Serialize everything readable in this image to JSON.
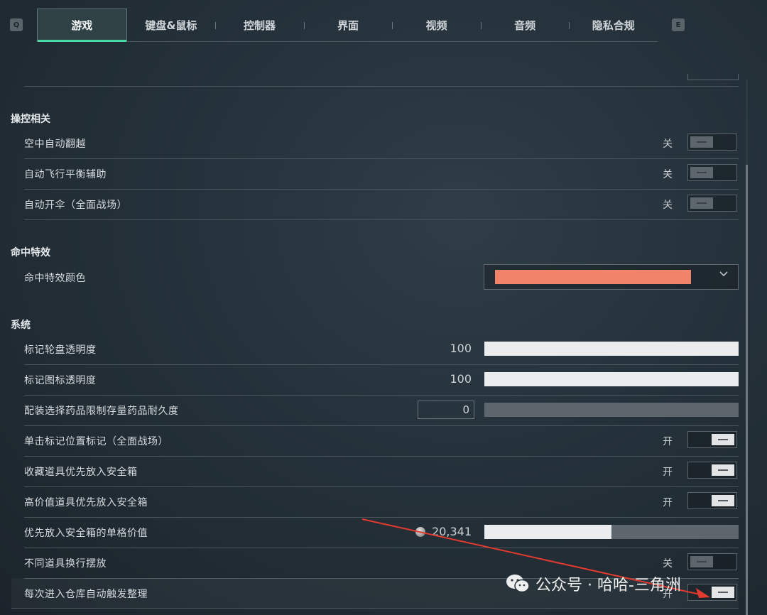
{
  "tabs": [
    {
      "label": "游戏",
      "active": true
    },
    {
      "label": "键盘&鼠标",
      "active": false
    },
    {
      "label": "控制器",
      "active": false
    },
    {
      "label": "界面",
      "active": false
    },
    {
      "label": "视频",
      "active": false
    },
    {
      "label": "音频",
      "active": false
    },
    {
      "label": "隐私合规",
      "active": false
    }
  ],
  "keys": {
    "left": "Q",
    "right": "E"
  },
  "sections": {
    "controls": "操控相关",
    "hit_effects": "命中特效",
    "system": "系统"
  },
  "controls": [
    {
      "label": "空中自动翻越",
      "state": "关",
      "on": false
    },
    {
      "label": "自动飞行平衡辅助",
      "state": "关",
      "on": false
    },
    {
      "label": "自动开伞（全面战场）",
      "state": "关",
      "on": false
    }
  ],
  "hit_effects": {
    "color_label": "命中特效颜色",
    "color_value": "#f2836b",
    "chevron": "chevron-down-icon"
  },
  "system": {
    "marker_wheel": {
      "label": "标记轮盘透明度",
      "value": "100",
      "fill": 1.0
    },
    "marker_icon": {
      "label": "标记图标透明度",
      "value": "100",
      "fill": 1.0
    },
    "loadout_limit": {
      "label": "配装选择药品限制存量药品耐久度",
      "value": "0",
      "fill": 0.0
    },
    "toggles": [
      {
        "label": "单击标记位置标记（全面战场）",
        "state": "开",
        "on": true
      },
      {
        "label": "收藏道具优先放入安全箱",
        "state": "开",
        "on": true
      },
      {
        "label": "高价值道具优先放入安全箱",
        "state": "开",
        "on": true
      }
    ],
    "priority_value": {
      "label": "优先放入安全箱的单格价值",
      "value": "20,341",
      "fill": 0.5,
      "icon": "coin-icon"
    },
    "toggles2": [
      {
        "label": "不同道具换行摆放",
        "state": "关",
        "on": false
      },
      {
        "label": "每次进入仓库自动触发整理",
        "state": "开",
        "on": true
      }
    ]
  },
  "watermark": {
    "text": "公众号 · 哈哈-三角洲",
    "icon": "wechat-icon"
  },
  "colors": {
    "accent": "#45d9a4",
    "arrow": "#e23a2f"
  }
}
